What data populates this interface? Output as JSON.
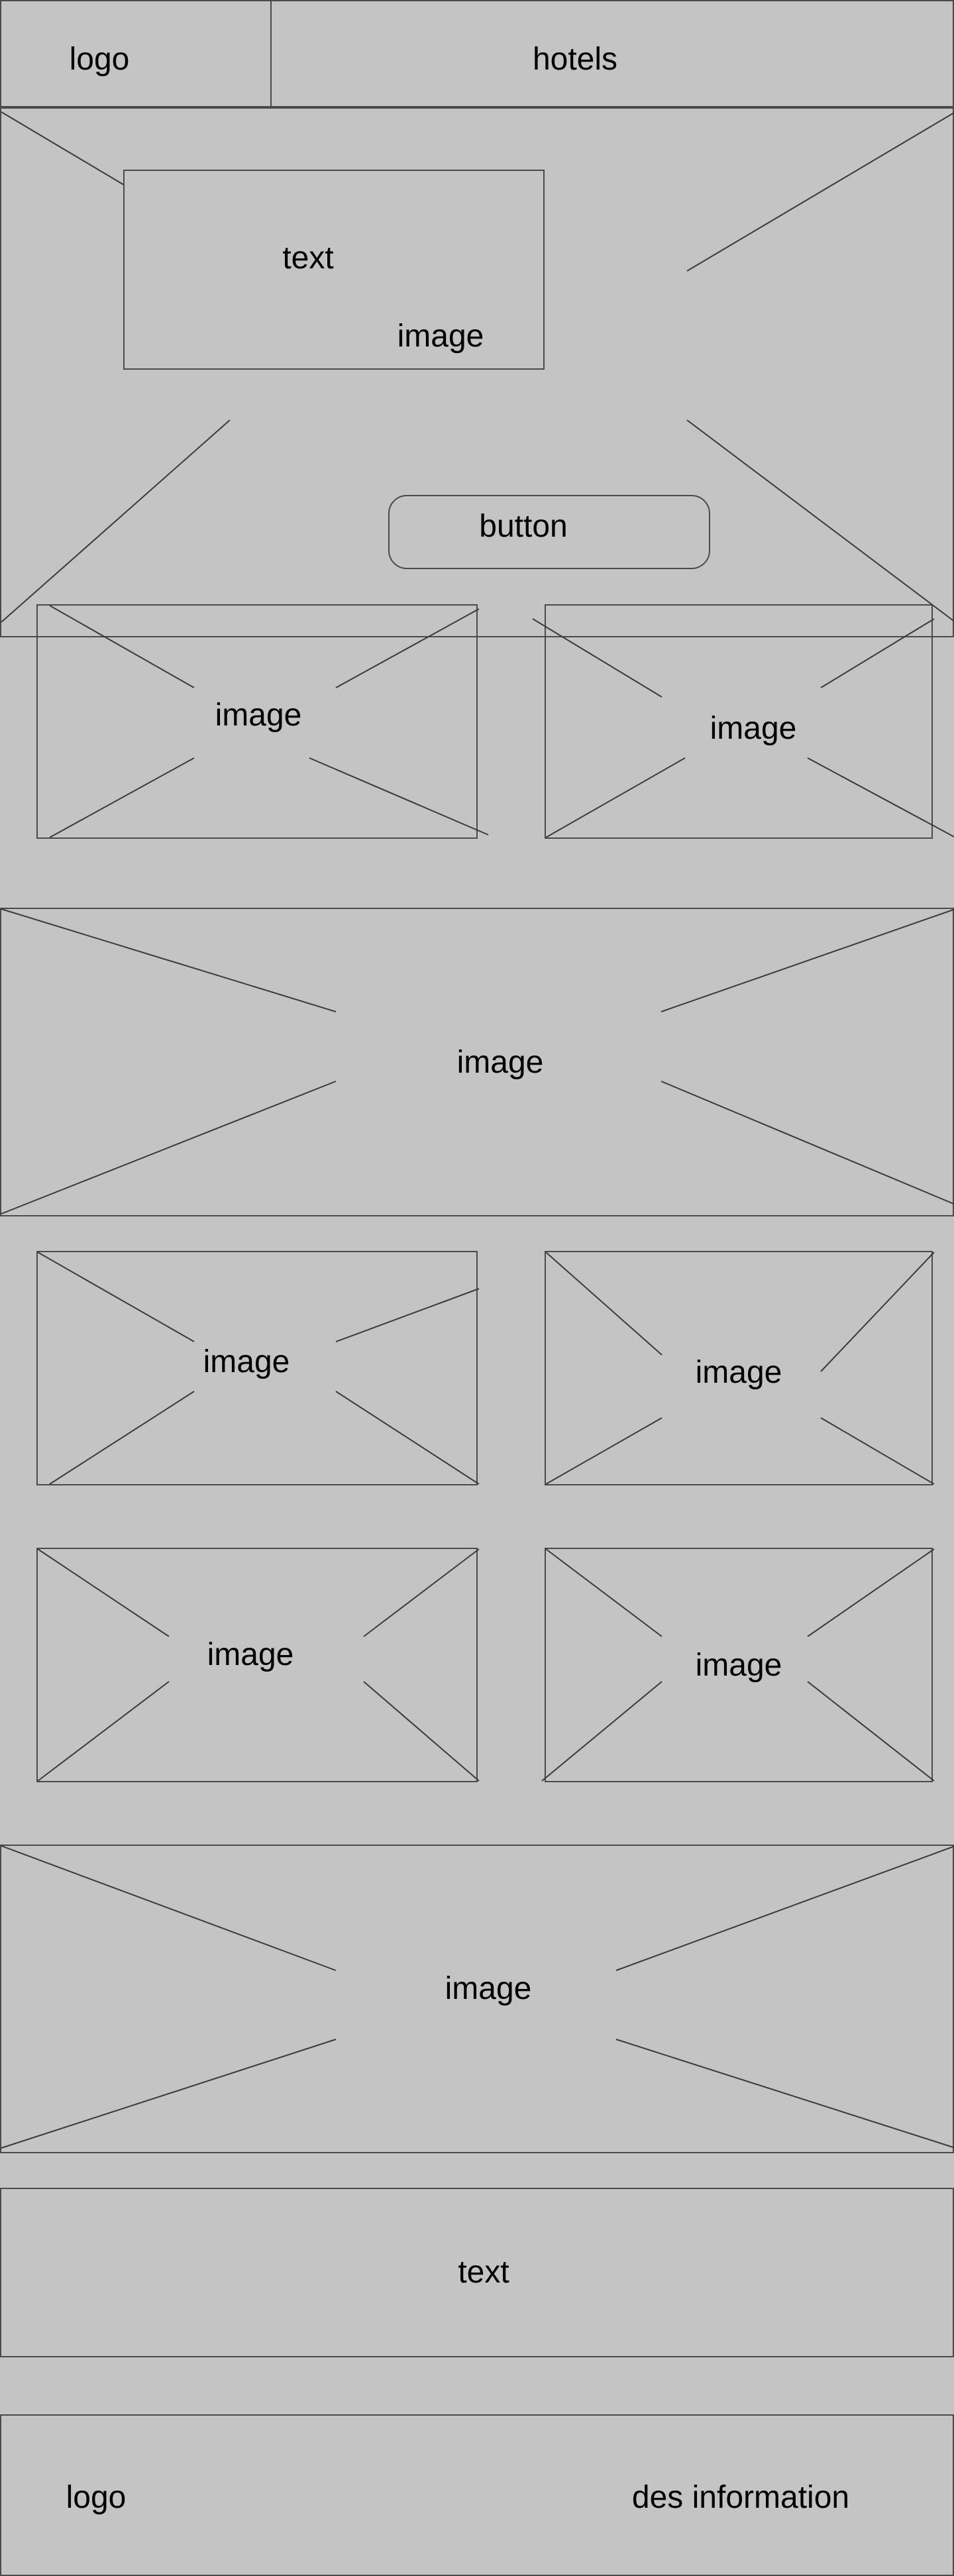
{
  "header": {
    "logo_label": "logo",
    "nav_label": "hotels"
  },
  "hero": {
    "text_label": "text",
    "image_label": "image",
    "button_label": "button"
  },
  "row1": {
    "left_label": "image",
    "right_label": "image"
  },
  "banner1": {
    "label": "image"
  },
  "grid": {
    "r1_left_label": "image",
    "r1_right_label": "image",
    "r2_left_label": "image",
    "r2_right_label": "image"
  },
  "banner2": {
    "label": "image"
  },
  "text_block": {
    "label": "text"
  },
  "footer": {
    "logo_label": "logo",
    "info_label": "des information"
  },
  "colors": {
    "background": "#c4c4c4",
    "stroke": "#4a4a4a"
  }
}
